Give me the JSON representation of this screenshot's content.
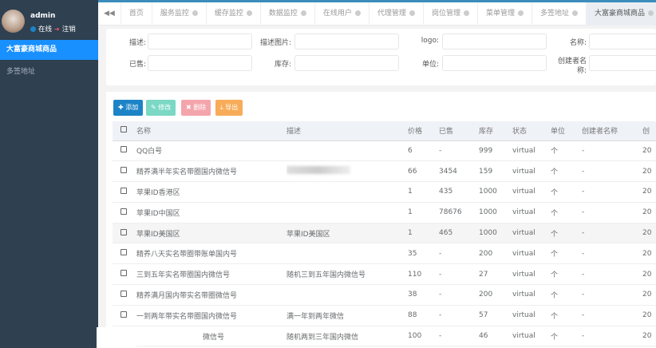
{
  "user": {
    "name": "admin",
    "status": "在线",
    "logout": "注销"
  },
  "sidebar": {
    "items": [
      {
        "label": "大富豪商城商品",
        "active": true
      },
      {
        "label": "多签地址",
        "active": false
      }
    ]
  },
  "tabs": [
    {
      "label": "首页",
      "closable": false
    },
    {
      "label": "服务监控",
      "closable": true
    },
    {
      "label": "缓存监控",
      "closable": true
    },
    {
      "label": "数据监控",
      "closable": true
    },
    {
      "label": "在线用户",
      "closable": true
    },
    {
      "label": "代理管理",
      "closable": true
    },
    {
      "label": "岗位管理",
      "closable": true
    },
    {
      "label": "菜单管理",
      "closable": true
    },
    {
      "label": "多签地址",
      "closable": true
    },
    {
      "label": "大富豪商城商品",
      "closable": true,
      "active": true
    }
  ],
  "search": {
    "desc": "描述:",
    "desc_img": "描述图片:",
    "logo": "logo:",
    "name": "名称:",
    "sold": "已售:",
    "stock": "库存:",
    "unit": "单位:",
    "creator": "创建者名称:"
  },
  "toolbar": {
    "add": "添加",
    "edit": "修改",
    "delete": "删除",
    "export": "导出"
  },
  "colors": {
    "add": "#1c84c6",
    "edit": "#7ad8c4",
    "delete": "#f4a5ac",
    "export": "#f8ac59",
    "active": "#1890ff"
  },
  "table": {
    "headers": [
      "名称",
      "描述",
      "价格",
      "已售",
      "库存",
      "状态",
      "单位",
      "创建者名称",
      "创"
    ],
    "rows": [
      [
        "QQ白号",
        "",
        "6",
        "-",
        "999",
        "virtual",
        "个",
        "-",
        "20"
      ],
      [
        "精养满半年实名带圈国内微信号",
        "",
        "66",
        "3454",
        "159",
        "virtual",
        "个",
        "-",
        "20"
      ],
      [
        "苹果ID香港区",
        "",
        "1",
        "435",
        "1000",
        "virtual",
        "个",
        "-",
        "20"
      ],
      [
        "苹果ID中国区",
        "",
        "1",
        "78676",
        "1000",
        "virtual",
        "个",
        "-",
        "20"
      ],
      [
        "苹果ID美国区",
        "苹果ID美国区",
        "1",
        "465",
        "1000",
        "virtual",
        "个",
        "-",
        "20"
      ],
      [
        "精养八天实名带圈带账单国内号",
        "",
        "35",
        "-",
        "200",
        "virtual",
        "个",
        "-",
        "20"
      ],
      [
        "三到五年实名带圈国内微信号",
        "随机三到五年国内微信号",
        "110",
        "-",
        "27",
        "virtual",
        "个",
        "-",
        "20"
      ],
      [
        "精养满月国内带实名带圈微信号",
        "",
        "38",
        "-",
        "200",
        "virtual",
        "个",
        "-",
        "20"
      ],
      [
        "一到两年带实名带圈国内微信号",
        "满一年到两年微信",
        "88",
        "-",
        "57",
        "virtual",
        "个",
        "-",
        "20"
      ],
      [
        "微信号",
        "随机两到三年国内微信",
        "100",
        "-",
        "46",
        "virtual",
        "个",
        "-",
        "20"
      ]
    ]
  }
}
